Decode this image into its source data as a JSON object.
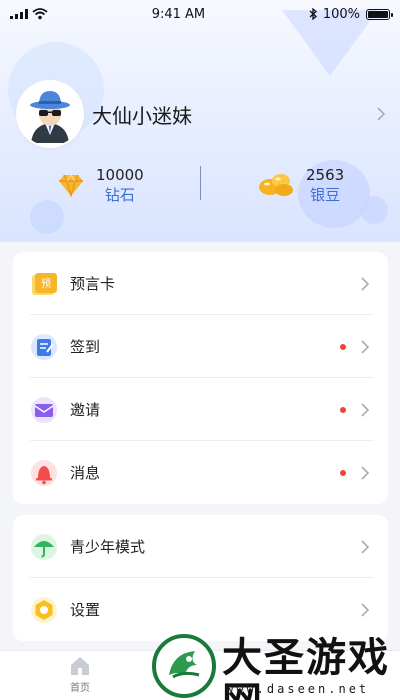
{
  "status_bar": {
    "time": "9:41 AM",
    "battery_text": "100%"
  },
  "profile": {
    "name": "大仙小迷妹"
  },
  "stats": {
    "diamond": {
      "value": "10000",
      "label": "钻石",
      "icon": "diamond-icon"
    },
    "silver": {
      "value": "2563",
      "label": "银豆",
      "icon": "gold-beans-icon"
    }
  },
  "menu_group_1": [
    {
      "label": "预言卡",
      "icon": "prophecy-card-icon",
      "badge": false
    },
    {
      "label": "签到",
      "icon": "sign-in-icon",
      "badge": true
    },
    {
      "label": "邀请",
      "icon": "invite-icon",
      "badge": true
    },
    {
      "label": "消息",
      "icon": "bell-icon",
      "badge": true
    }
  ],
  "menu_group_2": [
    {
      "label": "青少年模式",
      "icon": "umbrella-icon"
    },
    {
      "label": "设置",
      "icon": "settings-icon"
    }
  ],
  "tabbar": {
    "home_label": "首页"
  },
  "watermark": {
    "title": "大圣游戏网",
    "url": "www.daseen.net"
  },
  "colors": {
    "accent_blue": "#3a6fd8",
    "badge_red": "#f0433a",
    "header_gradient_top": "#f7f9ff",
    "header_gradient_bottom": "#d9e4ff"
  }
}
